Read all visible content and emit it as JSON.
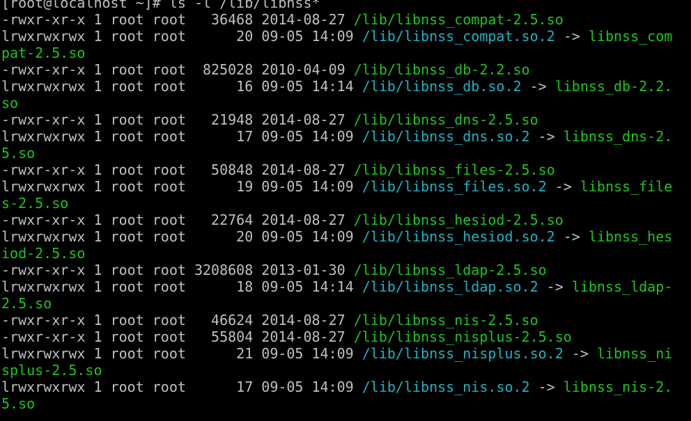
{
  "terminal": {
    "colors": {
      "background": "#000000",
      "default_text": "#c0c0c0",
      "exec_file": "#1ec51e",
      "symlink": "#20b2c0",
      "cursor": "#1ec51e"
    },
    "lines": [
      [
        {
          "t": "[root@localhost ~]# ls -l /lib/libnss*",
          "c": "default"
        }
      ],
      [
        {
          "t": "-rwxr-xr-x 1 root root   36468 2014-08-27 ",
          "c": "default"
        },
        {
          "t": "/lib/libnss_compat-2.5.so",
          "c": "exec"
        }
      ],
      [
        {
          "t": "lrwxrwxrwx 1 root root      20 09-05 14:09 ",
          "c": "default"
        },
        {
          "t": "/lib/libnss_compat.so.2",
          "c": "link"
        },
        {
          "t": " -> ",
          "c": "default"
        },
        {
          "t": "libnss_com",
          "c": "target"
        }
      ],
      [
        {
          "t": "pat-2.5.so",
          "c": "target"
        }
      ],
      [
        {
          "t": "-rwxr-xr-x 1 root root  825028 2010-04-09 ",
          "c": "default"
        },
        {
          "t": "/lib/libnss_db-2.2.so",
          "c": "exec"
        }
      ],
      [
        {
          "t": "lrwxrwxrwx 1 root root      16 09-05 14:14 ",
          "c": "default"
        },
        {
          "t": "/lib/libnss_db.so.2",
          "c": "link"
        },
        {
          "t": " -> ",
          "c": "default"
        },
        {
          "t": "libnss_db-2.2.",
          "c": "target"
        }
      ],
      [
        {
          "t": "so",
          "c": "target"
        }
      ],
      [
        {
          "t": "-rwxr-xr-x 1 root root   21948 2014-08-27 ",
          "c": "default"
        },
        {
          "t": "/lib/libnss_dns-2.5.so",
          "c": "exec"
        }
      ],
      [
        {
          "t": "lrwxrwxrwx 1 root root      17 09-05 14:09 ",
          "c": "default"
        },
        {
          "t": "/lib/libnss_dns.so.2",
          "c": "link"
        },
        {
          "t": " -> ",
          "c": "default"
        },
        {
          "t": "libnss_dns-2.",
          "c": "target"
        }
      ],
      [
        {
          "t": "5.so",
          "c": "target"
        }
      ],
      [
        {
          "t": "-rwxr-xr-x 1 root root   50848 2014-08-27 ",
          "c": "default"
        },
        {
          "t": "/lib/libnss_files-2.5.so",
          "c": "exec"
        }
      ],
      [
        {
          "t": "lrwxrwxrwx 1 root root      19 09-05 14:09 ",
          "c": "default"
        },
        {
          "t": "/lib/libnss_files.so.2",
          "c": "link"
        },
        {
          "t": " -> ",
          "c": "default"
        },
        {
          "t": "libnss_file",
          "c": "target"
        }
      ],
      [
        {
          "t": "s-2.5.so",
          "c": "target"
        }
      ],
      [
        {
          "t": "-rwxr-xr-x 1 root root   22764 2014-08-27 ",
          "c": "default"
        },
        {
          "t": "/lib/libnss_hesiod-2.5.so",
          "c": "exec"
        }
      ],
      [
        {
          "t": "lrwxrwxrwx 1 root root      20 09-05 14:09 ",
          "c": "default"
        },
        {
          "t": "/lib/libnss_hesiod.so.2",
          "c": "link"
        },
        {
          "t": " -> ",
          "c": "default"
        },
        {
          "t": "libnss_hes",
          "c": "target"
        }
      ],
      [
        {
          "t": "iod-2.5.so",
          "c": "target"
        }
      ],
      [
        {
          "t": "-rwxr-xr-x 1 root root 3208608 2013-01-30 ",
          "c": "default"
        },
        {
          "t": "/lib/libnss_ldap-2.5.so",
          "c": "exec"
        }
      ],
      [
        {
          "t": "lrwxrwxrwx 1 root root      18 09-05 14:14 ",
          "c": "default"
        },
        {
          "t": "/lib/libnss_ldap.so.2",
          "c": "link"
        },
        {
          "t": " -> ",
          "c": "default"
        },
        {
          "t": "libnss_ldap-",
          "c": "target"
        }
      ],
      [
        {
          "t": "2.5.so",
          "c": "target"
        }
      ],
      [
        {
          "t": "-rwxr-xr-x 1 root root   46624 2014-08-27 ",
          "c": "default"
        },
        {
          "t": "/lib/libnss_nis-2.5.so",
          "c": "exec"
        }
      ],
      [
        {
          "t": "-rwxr-xr-x 1 root root   55804 2014-08-27 ",
          "c": "default"
        },
        {
          "t": "/lib/libnss_nisplus-2.5.so",
          "c": "exec"
        }
      ],
      [
        {
          "t": "lrwxrwxrwx 1 root root      21 09-05 14:09 ",
          "c": "default"
        },
        {
          "t": "/lib/libnss_nisplus.so.2",
          "c": "link"
        },
        {
          "t": " -> ",
          "c": "default"
        },
        {
          "t": "libnss_ni",
          "c": "target"
        }
      ],
      [
        {
          "t": "splus-2.5.so",
          "c": "target"
        }
      ],
      [
        {
          "t": "lrwxrwxrwx 1 root root      17 09-05 14:09 ",
          "c": "default"
        },
        {
          "t": "/lib/libnss_nis.so.2",
          "c": "link"
        },
        {
          "t": " -> ",
          "c": "default"
        },
        {
          "t": "libnss_nis-2.",
          "c": "target"
        }
      ],
      [
        {
          "t": "5.so",
          "c": "target"
        }
      ]
    ]
  }
}
